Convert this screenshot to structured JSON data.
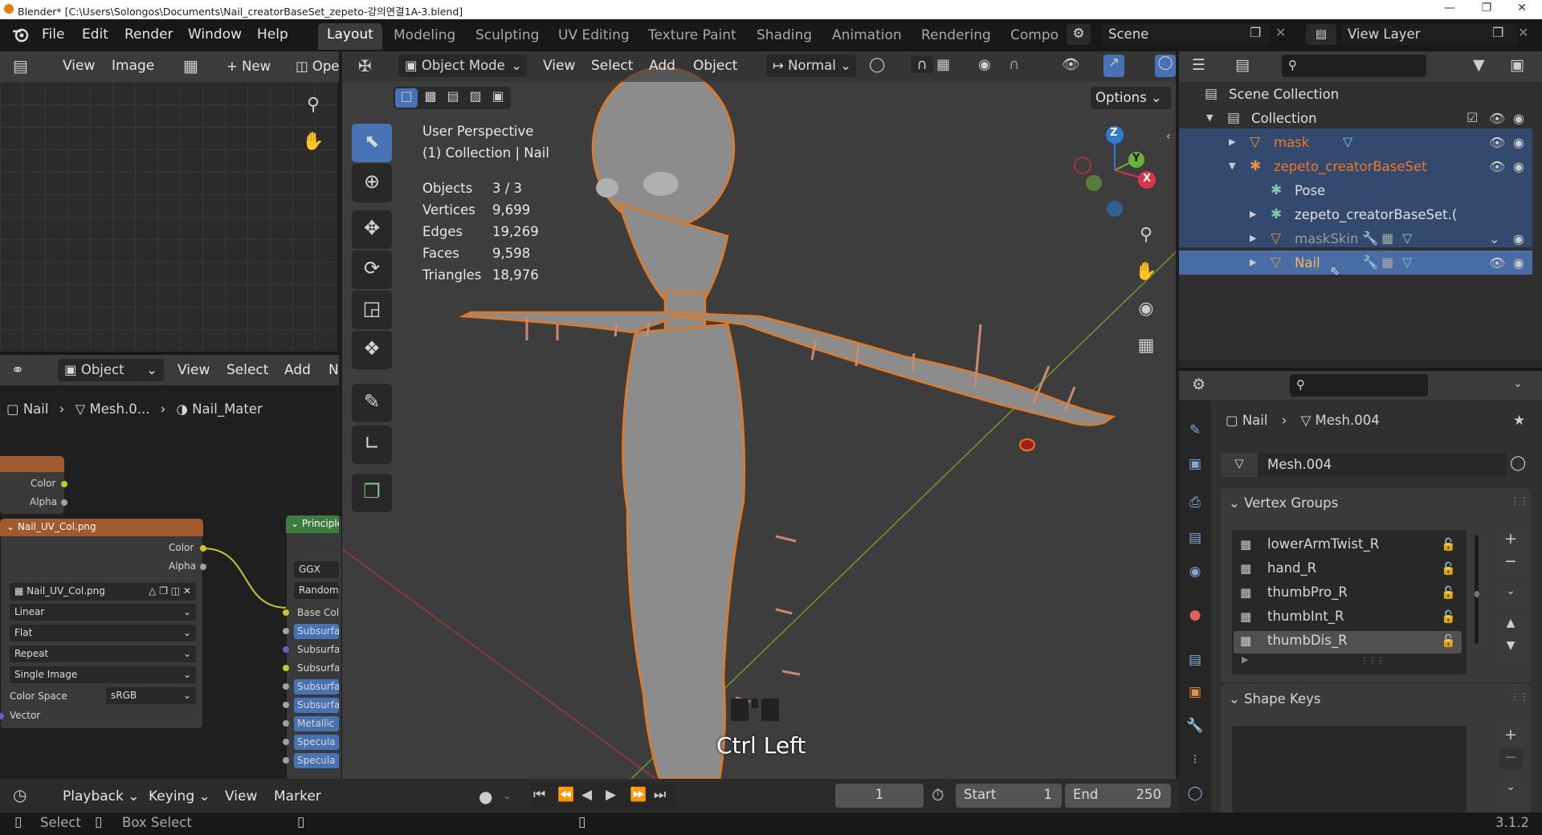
{
  "window": {
    "title": "Blender* [C:\\Users\\Solongos\\Documents\\Nail_creatorBaseSet_zepeto-강의연결1A-3.blend]"
  },
  "menus": [
    "File",
    "Edit",
    "Render",
    "Window",
    "Help"
  ],
  "workspaces": [
    "Layout",
    "Modeling",
    "Sculpting",
    "UV Editing",
    "Texture Paint",
    "Shading",
    "Animation",
    "Rendering",
    "Compo"
  ],
  "scene": {
    "name": "Scene",
    "view_layer": "View Layer"
  },
  "image_editor": {
    "view": "View",
    "image": "Image",
    "new": "New",
    "open": "Ope"
  },
  "node_editor": {
    "mode": "Object",
    "view": "View",
    "select": "Select",
    "add": "Add",
    "more": "No",
    "breadcrumb": [
      "Nail",
      "Mesh.0...",
      "Nail_Mater"
    ],
    "node_top": {
      "outputs": [
        "Color",
        "Alpha"
      ]
    },
    "image_node": {
      "title": "Nail_UV_Col.png",
      "outputs": [
        "Color",
        "Alpha"
      ],
      "image_name": "Nail_UV_Col.png",
      "interpolation": "Linear",
      "projection": "Flat",
      "extension": "Repeat",
      "source": "Single Image",
      "color_space_label": "Color Space",
      "color_space": "sRGB",
      "vector": "Vector"
    },
    "principled": {
      "title": "Principle",
      "distribution": "GGX",
      "subsurface_method": "Random",
      "inputs": [
        "Base Colo",
        "Subsurfa",
        "Subsurfa",
        "Subsurfac",
        "Subsurfa",
        "Subsurfa",
        "Metallic",
        "Specula",
        "Specula"
      ]
    }
  },
  "viewport": {
    "mode": "Object Mode",
    "view": "View",
    "select": "Select",
    "add": "Add",
    "object": "Object",
    "orientation": "Normal",
    "options": "Options",
    "perspective": "User Perspective",
    "collection_info": "(1) Collection | Nail",
    "stats": [
      {
        "label": "Objects",
        "value": "3 / 3"
      },
      {
        "label": "Vertices",
        "value": "9,699"
      },
      {
        "label": "Edges",
        "value": "19,269"
      },
      {
        "label": "Faces",
        "value": "9,598"
      },
      {
        "label": "Triangles",
        "value": "18,976"
      }
    ],
    "keystroke": "Ctrl Left",
    "gizmo_axes": [
      "Z",
      "Y",
      "X"
    ]
  },
  "outliner": {
    "rows": [
      {
        "label": "Scene Collection",
        "icon": "scene-collection-icon"
      },
      {
        "label": "Collection",
        "icon": "collection-icon"
      },
      {
        "label": "mask",
        "icon": "mesh-icon"
      },
      {
        "label": "zepeto_creatorBaseSet",
        "icon": "armature-icon"
      },
      {
        "label": "Pose",
        "icon": "pose-icon"
      },
      {
        "label": "zepeto_creatorBaseSet.(",
        "icon": "armature-data-icon"
      },
      {
        "label": "maskSkin",
        "icon": "mesh-icon"
      },
      {
        "label": "Nail",
        "icon": "mesh-icon"
      }
    ]
  },
  "properties": {
    "breadcrumb": [
      "Nail",
      "Mesh.004"
    ],
    "mesh_name": "Mesh.004",
    "vertex_groups_title": "Vertex Groups",
    "vertex_groups": [
      "lowerArmTwist_R",
      "hand_R",
      "thumbPro_R",
      "thumbInt_R",
      "thumbDis_R"
    ],
    "shape_keys_title": "Shape Keys"
  },
  "timeline": {
    "playback": "Playback",
    "keying": "Keying",
    "view": "View",
    "marker": "Marker",
    "current_frame": "1",
    "start_label": "Start",
    "start": "1",
    "end_label": "End",
    "end": "250"
  },
  "statusbar": {
    "select": "Select",
    "box_select": "Box Select",
    "version": "3.1.2"
  },
  "colors": {
    "accent": "#4772b3",
    "selected_outline": "#e6781e",
    "header": "#3b3b3b",
    "panel": "#303030"
  }
}
